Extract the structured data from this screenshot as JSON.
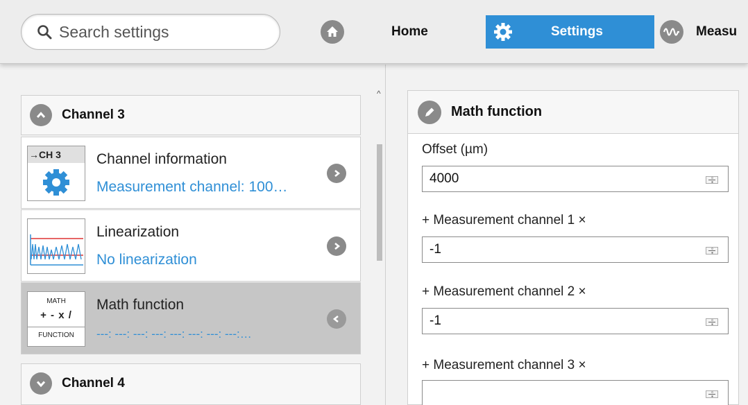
{
  "search": {
    "placeholder": "Search settings"
  },
  "tabs": [
    {
      "label": "Home",
      "icon": "home-icon"
    },
    {
      "label": "Settings",
      "icon": "gear-icon",
      "active": true
    },
    {
      "label": "Measu",
      "icon": "waveform-icon"
    }
  ],
  "colors": {
    "accent": "#2f8fd6",
    "icon_grey": "#8a8a8a",
    "selected_bg": "#c6c6c6"
  },
  "left": {
    "group1": {
      "title": "Channel 3",
      "icon": "chevron-up-icon",
      "expanded": true
    },
    "items": [
      {
        "thumb_label": "→CH 3",
        "name": "Channel information",
        "sub": "Measurement channel: 100…",
        "icon": "chevron-right-icon"
      },
      {
        "name": "Linearization",
        "sub": "No linearization",
        "icon": "chevron-right-icon"
      },
      {
        "thumb_top": "MATH",
        "thumb_mid": "+ - x /",
        "thumb_bot": "FUNCTION",
        "name": "Math function",
        "sub": "---: ---: ---: ---: ---: ---: ---: ---:…",
        "icon": "chevron-left-icon",
        "selected": true
      }
    ],
    "group2": {
      "title": "Channel 4",
      "icon": "chevron-down-icon",
      "expanded": false
    }
  },
  "right": {
    "title": "Math function",
    "fields": [
      {
        "label": "Offset (µm)",
        "value": "4000"
      },
      {
        "label": "+ Measurement channel 1 ×",
        "value": "-1"
      },
      {
        "label": "+ Measurement channel 2 ×",
        "value": "-1"
      },
      {
        "label": "+ Measurement channel 3 ×",
        "value": ""
      }
    ]
  }
}
